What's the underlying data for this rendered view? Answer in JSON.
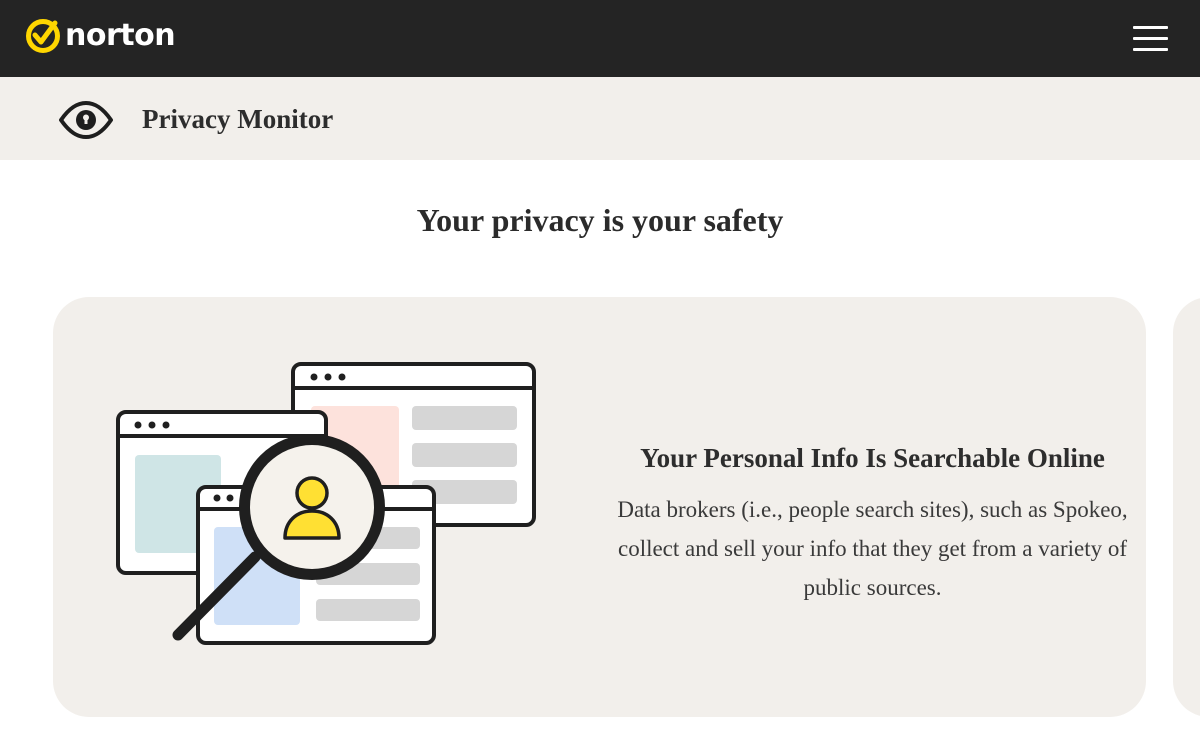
{
  "header": {
    "brand": "norton",
    "logo_icon": "norton-check-icon",
    "menu_icon": "hamburger-menu-icon"
  },
  "product_bar": {
    "icon": "eye-icon",
    "title": "Privacy Monitor"
  },
  "main": {
    "heading": "Your privacy is your safety",
    "card": {
      "illustration": "people-search-illustration",
      "title": "Your Personal Info Is Searchable Online",
      "body": "Data brokers (i.e., people search sites), such as Spokeo, collect and sell your info that they get from a variety of public sources."
    }
  },
  "colors": {
    "top_bar": "#242424",
    "accent_yellow": "#ffd600",
    "surface": "#f2efeb",
    "text": "#2b2b2b"
  }
}
